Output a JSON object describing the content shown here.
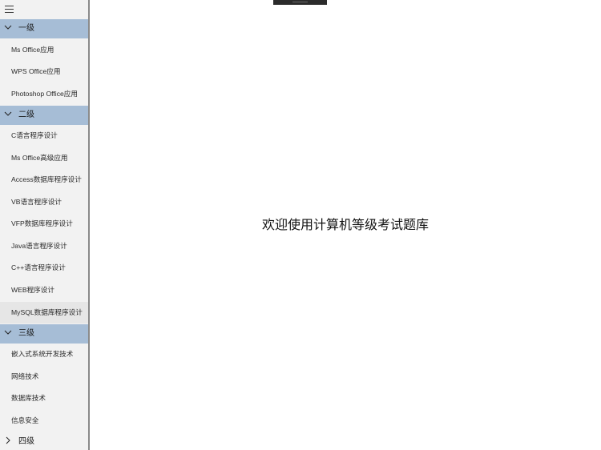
{
  "window": {
    "welcome_text": "欢迎使用计算机等级考试题库"
  },
  "sidebar": {
    "menu_icon": "hamburger-menu-icon",
    "groups": [
      {
        "label": "一级",
        "expanded": true,
        "items": [
          "Ms Office应用",
          "WPS Office应用",
          "Photoshop Office应用"
        ]
      },
      {
        "label": "二级",
        "expanded": true,
        "items": [
          "C语言程序设计",
          "Ms Office高级应用",
          "Access数据库程序设计",
          "VB语言程序设计",
          "VFP数据库程序设计",
          "Java语言程序设计",
          "C++语言程序设计",
          "WEB程序设计",
          "MySQL数据库程序设计"
        ]
      },
      {
        "label": "三级",
        "expanded": true,
        "items": [
          "嵌入式系统开发技术",
          "网络技术",
          "数据库技术",
          "信息安全"
        ]
      },
      {
        "label": "四级",
        "expanded": false,
        "items": []
      }
    ],
    "selected_item": "MySQL数据库程序设计"
  },
  "colors": {
    "group_header_bg": "#a6bdd6",
    "sidebar_bg": "#f2f2f2",
    "selected_item_bg": "#e6e6e6"
  }
}
